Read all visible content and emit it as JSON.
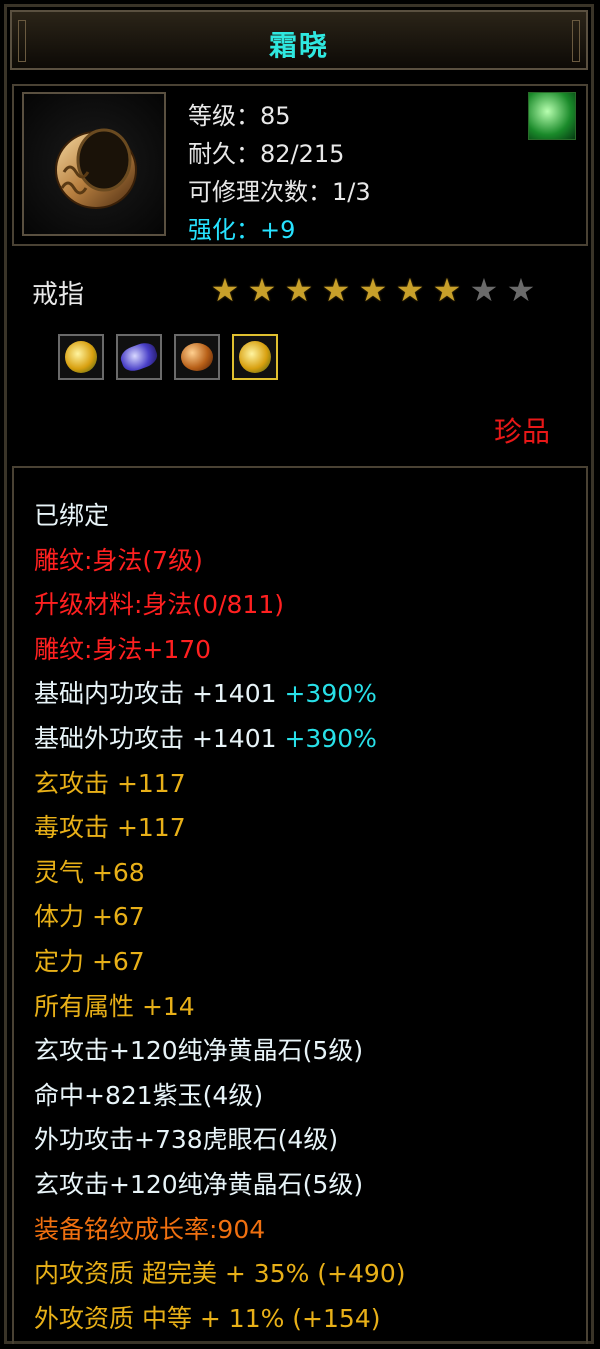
{
  "item": {
    "name": "霜晓",
    "level": "等级：85",
    "durability": "耐久：82/215",
    "repairs": "可修理次数：1/3",
    "enhance": "强化：+9",
    "type": "戒指",
    "stars_total": 9,
    "stars_filled": 7,
    "rarity": "珍品",
    "icon": "ring-icon",
    "corner_icon": "green-gem-icon",
    "sockets": [
      {
        "name": "yellow-crystal-gem-icon",
        "selected": false
      },
      {
        "name": "purple-jade-gem-icon",
        "selected": false
      },
      {
        "name": "tiger-eye-gem-icon",
        "selected": false
      },
      {
        "name": "yellow-crystal-gem-icon",
        "selected": true
      }
    ]
  },
  "details": [
    {
      "text": "已绑定",
      "color": "#e8f4f8"
    },
    {
      "text": "雕纹:身法(7级)",
      "color": "#ff2020"
    },
    {
      "text": "升级材料:身法(0/811)",
      "color": "#ff2020"
    },
    {
      "text": "雕纹:身法+170",
      "color": "#ff2020"
    },
    {
      "text": "基础内功攻击 +1401 ",
      "extra": "+390%",
      "color": "#e8f4f8"
    },
    {
      "text": "基础外功攻击 +1401 ",
      "extra": "+390%",
      "color": "#e8f4f8"
    },
    {
      "text": "玄攻击 +117",
      "color": "#e8b018"
    },
    {
      "text": "毒攻击 +117",
      "color": "#e8b018"
    },
    {
      "text": "灵气 +68",
      "color": "#e8b018"
    },
    {
      "text": "体力 +67",
      "color": "#e8b018"
    },
    {
      "text": "定力 +67",
      "color": "#e8b018"
    },
    {
      "text": "所有属性 +14",
      "color": "#e8b018"
    },
    {
      "text": "玄攻击+120纯净黄晶石(5级)",
      "color": "#e8f4f8"
    },
    {
      "text": "命中+821紫玉(4级)",
      "color": "#e8f4f8"
    },
    {
      "text": "外功攻击+738虎眼石(4级)",
      "color": "#e8f4f8"
    },
    {
      "text": "玄攻击+120纯净黄晶石(5级)",
      "color": "#e8f4f8"
    },
    {
      "text": "装备铭纹成长率:904",
      "color": "#f07010"
    },
    {
      "text": "内攻资质 超完美 + 35% (+490)",
      "color": "#e8b018"
    },
    {
      "text": "外攻资质 中等 + 11% (+154)",
      "color": "#e8b018"
    }
  ]
}
